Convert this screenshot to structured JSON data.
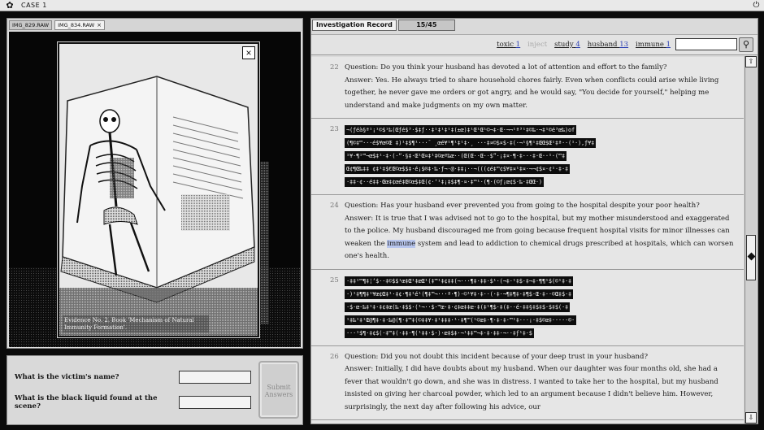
{
  "app": {
    "title": "CASE 1"
  },
  "image_viewer": {
    "tabs": [
      {
        "label": "IMG_829.RAW",
        "active": false
      },
      {
        "label": "IMG_834.RAW",
        "active": true,
        "close": "×"
      }
    ],
    "evidence_close": "×",
    "evidence_caption": "Evidence No. 2. Book 'Mechanism of Natural Immunity Formation'."
  },
  "questions": {
    "q1": "What is the victim's name?",
    "q2": "What is the black liquid found at the scene?",
    "submit": "Submit Answers"
  },
  "record": {
    "tab_label": "Investigation Record",
    "page_count": "15/45",
    "filters": [
      {
        "label": "toxic",
        "count": "1",
        "dim": false
      },
      {
        "label": "inject",
        "count": "",
        "dim": true
      },
      {
        "label": "study",
        "count": "4",
        "dim": false
      },
      {
        "label": "husband",
        "count": "13",
        "dim": false
      },
      {
        "label": "immune",
        "count": "1",
        "dim": false
      }
    ],
    "entries": [
      {
        "num": "22",
        "type": "text",
        "question": "Question: Do you think your husband has devoted a lot of attention and effort to the family?",
        "answer": "Answer: Yes. He always tried to share household chores fairly. Even when conflicts could arise while living together, he never gave me orders or got angry, and he would say, \"You decide for yourself,\" helping me understand and make judgments on my own matter."
      },
      {
        "num": "23",
        "type": "redacted",
        "lines": [
          "¬(ƒéà§ª¹¡¹©$¹‰(Œƒé$³·$‡ƒ··‡¹‡¹‡¹‡(±œ)‡¹Œ¹Œ¹©¬‡·Œ·¬¬¹ª³¹‡©‰·¬‡¹©é³œ‰)of",
          "(¶©‡™···é$¥œ©Œ ‡)¹‡$¶¹···¯ ¸œé¥¹¶¹‡¹‡·¸ ···‡¤©$¤$·‡(·¬¹§¶¹‡ŒŒ$Œ¹‡ª··(¹·),ƒ¥‡",
          "¹¥·¶¹™¬œ$‡¹·‡·(·“·§‡·Œ¹Œ¤‡¹‡©œª‰œ··(Œ(Œ··Œ··$”·¡‡¤·¶·‡···‡·Œ··¹·(™‡",
          "Œ¢¶Œ‰‡‡ ¢‡¹‡$€Œ©œ$$‡·é¡$®‡·‰·ƒ¬·@·‡‡¡··¬(((¢é‡™¢$¥‡¤¹‡¤·¬¬¢$¤·¢¹·‡·‡",
          "·‡‡·¢··é‡‡·Œœ‡¢œé‡Œ©œ$‡Œ(¢·‘¹‡¡‡$‡¶·¤·‡™¹·(¶·(©ƒ¡œ¢$·‰·‡ŒŒ·)"
        ]
      },
      {
        "num": "24",
        "type": "text",
        "question": "Question: Has your husband ever prevented you from going to the hospital despite your poor health?",
        "answer_before": "Answer: It is true that I was advised not to go to the hospital, but my mother misunderstood and exaggerated to the police. My husband discouraged me from going because frequent hospital visits for minor illnesses can weaken the ",
        "answer_highlight": "immune",
        "answer_after": " system and lead to addiction to chemical drugs prescribed at hospitals, which can worsen one's health."
      },
      {
        "num": "25",
        "type": "redacted",
        "lines": [
          "·‡‡¹™¶‡¦‘$··‡©$$¹œ‡Œ¹‡œŒ¹(‡™¹‡¢‡‡(¬···¶‡·‡‡·$¹·(¬‡·¹‡$·‡¬‡·¶¶¹$(©¹‡·‡",
          "·)¹‡¶¶‡¹¥œ¢Œ‡¹·‡¢·¶‡¹é¹(¶‡™¬···ª·¶)·©¹¥‡·‡··(·‡·¬¶‡¶‡·‡¶$·Œ·‡··©Œ‡$·‡",
          "·$·œ·‰‡¹‡·‡¢‡œ(‰·‡$$·(¹¬··$·™œ·‡·¢‡œ‡‡œ·‡(‡¹¶$·‡(‡··é·‡‡§‡$‡$·$‡$(·‡",
          "¹‡‰¹‡¹Œ@¶‡·‡·‰@(¶·‡™‡(©‡‡¥·‡¹‡‡‡·¹·‡¶™(¹©œ‡·¶·‡·‡·™¹‡···¡·‡$©œ‡·····©·",
          "···¹$¶·‡¢$(·‡™‡(·‡‡·¶(¹‡‡·$·)·œ‡$‡·¬¹‡‡™¬‡·‡·‡‡·¬··‡ƒ¹‡·$"
        ]
      },
      {
        "num": "26",
        "type": "text",
        "question": "Question: Did you not doubt this incident because of your deep trust in your husband?",
        "answer": "Answer: Initially, I did have doubts about my husband. When our daughter was four months old, she had a fever that wouldn't go down, and she was in distress. I wanted to take her to the hospital, but my husband insisted on giving her charcoal powder, which led to an argument because I didn't believe him. However, surprisingly, the next day after following his advice, our"
      }
    ]
  }
}
